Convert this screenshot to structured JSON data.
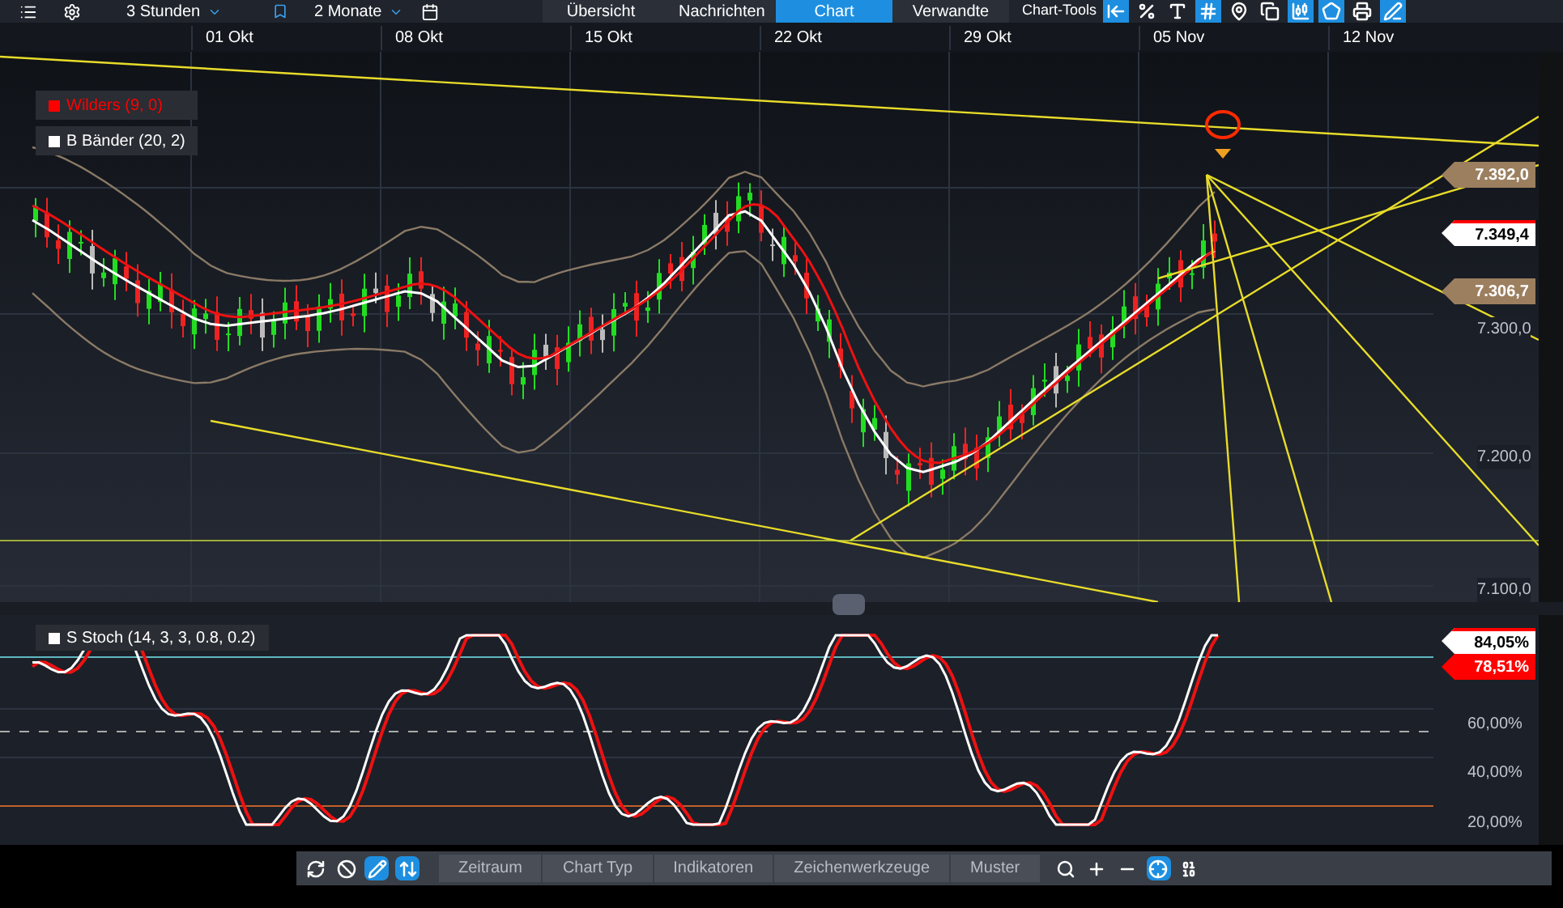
{
  "toolbar": {
    "interval": "3 Stunden",
    "range": "2 Monate",
    "tabs": [
      {
        "label": "Übersicht",
        "selected": false
      },
      {
        "label": "Nachrichten",
        "selected": false
      },
      {
        "label": "Chart",
        "selected": true
      },
      {
        "label": "Verwandte",
        "selected": false
      }
    ],
    "tools_label": "Chart-Tools",
    "tools": [
      {
        "kind": "back",
        "active": true
      },
      {
        "kind": "percent",
        "active": false
      },
      {
        "kind": "text",
        "active": false
      },
      {
        "kind": "grid",
        "active": true
      },
      {
        "kind": "pin",
        "active": false
      },
      {
        "kind": "windows",
        "active": false
      },
      {
        "kind": "candles",
        "active": true
      },
      {
        "kind": "shape",
        "active": true
      },
      {
        "kind": "print",
        "active": false
      },
      {
        "kind": "edit",
        "active": true
      }
    ]
  },
  "date_axis": [
    "01 Okt",
    "08 Okt",
    "15 Okt",
    "22 Okt",
    "29 Okt",
    "05 Nov",
    "12 Nov"
  ],
  "price_panel": {
    "legends": [
      {
        "label": "Wilders (9, 0)",
        "color": "#ff0000"
      },
      {
        "label": "B Bänder (20, 2)",
        "color": "#ffffff"
      }
    ],
    "tags": [
      {
        "text": "7.392,0",
        "kind": "band"
      },
      {
        "text": "7.349,4",
        "kind": "last"
      },
      {
        "text": "7.306,7",
        "kind": "band"
      }
    ],
    "y_labels": [
      "7.300,0",
      "7.200,0",
      "7.100,0"
    ]
  },
  "stoch_panel": {
    "legend": {
      "label": "S Stoch (14, 3, 3, 0.8, 0.2)",
      "color": "#ffffff"
    },
    "tags": [
      {
        "text": "84,05%",
        "kind": "last"
      },
      {
        "text": "78,51%",
        "kind": "signal"
      }
    ],
    "y_labels": [
      "60,00%",
      "40,00%",
      "20,00%"
    ]
  },
  "bottom_bar": {
    "left_tools": [
      {
        "kind": "refresh",
        "active": false
      },
      {
        "kind": "ban",
        "active": false
      },
      {
        "kind": "pencil",
        "active": true
      },
      {
        "kind": "updown",
        "active": true
      }
    ],
    "tabs": [
      "Zeitraum",
      "Chart Typ",
      "Indikatoren",
      "Zeichenwerkzeuge",
      "Muster"
    ],
    "right_tools": [
      {
        "kind": "search",
        "active": false
      },
      {
        "kind": "plus",
        "active": false
      },
      {
        "kind": "minus",
        "active": false
      },
      {
        "kind": "crosshair",
        "active": true
      },
      {
        "kind": "numbers",
        "active": false
      }
    ]
  }
}
